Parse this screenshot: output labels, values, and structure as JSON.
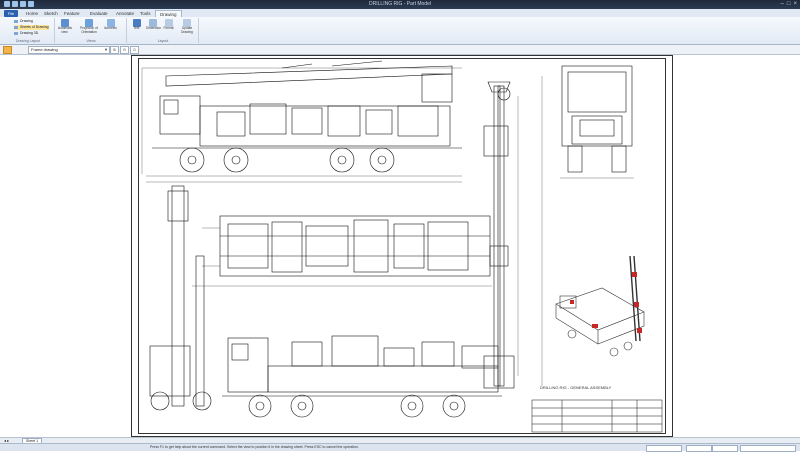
{
  "window": {
    "title": "DRILLING RIG - Part Model"
  },
  "menu": {
    "file": "File",
    "tabs": [
      "Home",
      "Sketch",
      "Feature",
      "Evaluate",
      "Annotate",
      "Tools",
      "Drawing"
    ],
    "active_tab": "Drawing"
  },
  "ribbon": {
    "rows": [
      "Drawing",
      "Sheets of Drawing",
      "Drawing 3D"
    ],
    "row_group_label": "Drawing Layout",
    "button1": "Automatic view",
    "button2": "Projection of Orientation",
    "button3": "Isometric",
    "group1_label": "Views",
    "button4": "Text",
    "button5": "Dimension",
    "button6": "Format",
    "button7": "Update Drawing",
    "group2_label": "Layout"
  },
  "toolbar": {
    "layer_select": "Frame drawing"
  },
  "drawing": {
    "caption": "DRILLING RIG - GENERAL ASSEMBLY"
  },
  "sheet_tab": "Sheet 1",
  "status": {
    "message": "Press F1 to get help about the current command. Select the view to position it in the drawing sheet. Press ESC to cancel the operation."
  },
  "colors": {
    "accent": "#2b5fb0",
    "selection": "#fbe49b"
  }
}
